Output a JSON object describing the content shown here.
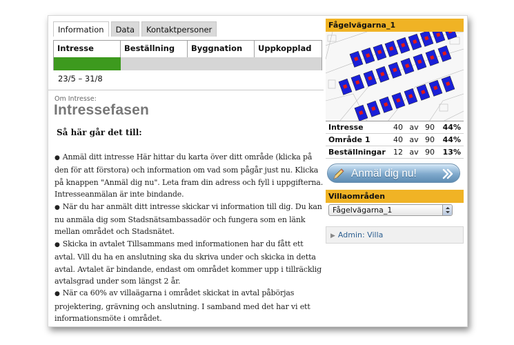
{
  "tabs": [
    {
      "label": "Information",
      "active": true
    },
    {
      "label": "Data",
      "active": false
    },
    {
      "label": "Kontaktpersoner",
      "active": false
    }
  ],
  "progress": {
    "stages": [
      "Intresse",
      "Beställning",
      "Byggnation",
      "Uppkopplad"
    ],
    "current_stage": 1,
    "fill_color": "#3d9a1e"
  },
  "dates": "23/5 – 31/8",
  "section_label": "Om Intresse:",
  "phase_title": "Intressefasen",
  "how_heading": "Så här går det till:",
  "steps": [
    "Anmäl ditt intresse Här hittar du karta över ditt område (klicka på den för att förstora) och information om vad som pågår just nu. Klicka på knappen \"Anmäl dig nu\". Leta fram din adress och fyll i uppgifterna. Intresseanmälan är inte bindande.",
    "När du har anmält ditt intresse skickar vi information till dig. Du kan nu anmäla dig som Stadsnätsambassadör och fungera som en länk mellan området och Stadsnätet.",
    "Skicka in avtalet Tillsammans med informationen har du fått ett avtal. Vill du ha en anslutning ska du skriva under och skicka in detta avtal. Avtalet är bindande, endast om området kommer upp i tillräcklig avtalsgrad under som längst 2 år.",
    "När ca 60% av villaägarna i området skickat in avtal påbörjas projektering, grävning och anslutning. I samband med det har vi ett informationsmöte i området."
  ],
  "map_box": {
    "title": "Fågelvägarna_1",
    "header_color": "#f0b325",
    "stats": [
      {
        "label": "Intresse",
        "count": "40",
        "of": "av",
        "total": "90",
        "percent": "44%"
      },
      {
        "label": "Område 1",
        "count": "40",
        "of": "av",
        "total": "90",
        "percent": "44%"
      },
      {
        "label": "Beställningar",
        "count": "12",
        "of": "av",
        "total": "90",
        "percent": "13%"
      }
    ]
  },
  "signup_button": {
    "label": "Anmäl dig nu!",
    "icon": "pencil-icon",
    "chevron": "double-chevron-right-icon"
  },
  "villa_box": {
    "title": "Villaområden",
    "selected": "Fågelvägarna_1"
  },
  "admin_link": {
    "label": "Admin: Villa",
    "icon": "triangle-right-icon"
  }
}
